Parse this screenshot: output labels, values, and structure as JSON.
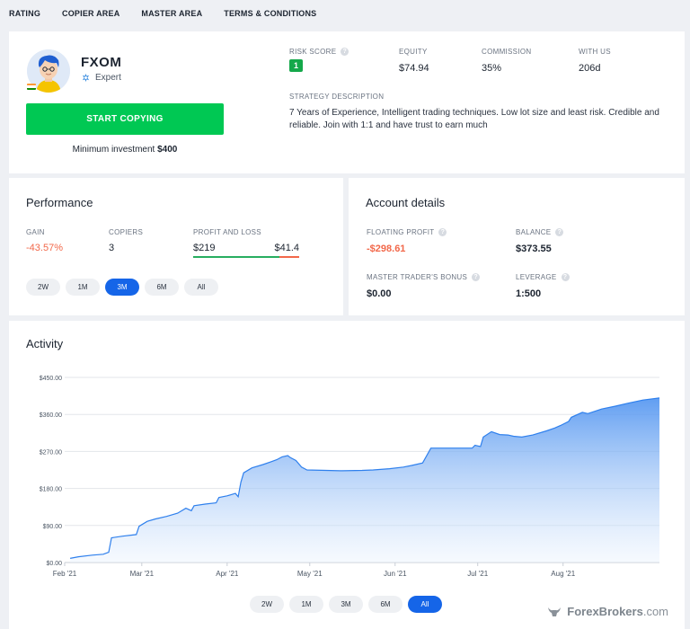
{
  "nav": {
    "items": [
      "RATING",
      "COPIER AREA",
      "MASTER AREA",
      "TERMS & CONDITIONS"
    ]
  },
  "profile": {
    "name": "FXOM",
    "level": "Expert",
    "start_button": "START COPYING",
    "min_investment_label": "Minimum investment",
    "min_investment_value": "$400",
    "risk_score_label": "RISK SCORE",
    "risk_score_value": "1",
    "equity_label": "EQUITY",
    "equity_value": "$74.94",
    "commission_label": "COMMISSION",
    "commission_value": "35%",
    "with_us_label": "WITH US",
    "with_us_value": "206d",
    "strategy_label": "STRATEGY DESCRIPTION",
    "strategy_text": "7 Years of Experience, Intelligent trading techniques. Low lot size and least risk. Credible and reliable. Join with 1:1 and have trust to earn much"
  },
  "performance": {
    "title": "Performance",
    "gain_label": "GAIN",
    "gain_value": "-43.57%",
    "copiers_label": "COPIERS",
    "copiers_value": "3",
    "pl_label": "PROFIT AND LOSS",
    "pl_profit": "$219",
    "pl_loss": "$41.4",
    "periods": [
      "2W",
      "1M",
      "3M",
      "6M",
      "All"
    ],
    "active_period": "3M"
  },
  "account": {
    "title": "Account details",
    "floating_profit_label": "FLOATING PROFIT",
    "floating_profit_value": "-$298.61",
    "balance_label": "BALANCE",
    "balance_value": "$373.55",
    "bonus_label": "MASTER TRADER'S BONUS",
    "bonus_value": "$0.00",
    "leverage_label": "LEVERAGE",
    "leverage_value": "1:500"
  },
  "activity": {
    "title": "Activity",
    "periods": [
      "2W",
      "1M",
      "3M",
      "6M",
      "All"
    ],
    "active_period": "All"
  },
  "watermark": {
    "brand": "ForexBrokers",
    "suffix": ".com"
  },
  "colors": {
    "accent_green": "#00c853",
    "accent_blue": "#1565e8",
    "negative": "#f2684a",
    "line": "#2f80ed"
  },
  "chart_data": {
    "type": "area",
    "title": "Activity",
    "xlabel": "",
    "ylabel": "",
    "ylim": [
      0,
      450
    ],
    "y_ticks": [
      "$0.00",
      "$90.00",
      "$180.00",
      "$270.00",
      "$360.00",
      "$450.00"
    ],
    "y_tick_values": [
      0,
      90,
      180,
      270,
      360,
      450
    ],
    "x_ticks": [
      "Feb '21",
      "Mar '21",
      "Apr '21",
      "May '21",
      "Jun '21",
      "Jul '21",
      "Aug '21"
    ],
    "x_tick_days": [
      0,
      28,
      59,
      89,
      120,
      150,
      181
    ],
    "grid": true,
    "series": [
      {
        "points": [
          [
            2,
            10
          ],
          [
            5,
            14
          ],
          [
            10,
            18
          ],
          [
            14,
            20
          ],
          [
            16,
            25
          ],
          [
            17,
            60
          ],
          [
            21,
            64
          ],
          [
            26,
            68
          ],
          [
            27,
            88
          ],
          [
            30,
            100
          ],
          [
            33,
            106
          ],
          [
            37,
            112
          ],
          [
            41,
            120
          ],
          [
            44,
            132
          ],
          [
            46,
            126
          ],
          [
            47,
            138
          ],
          [
            51,
            142
          ],
          [
            55,
            145
          ],
          [
            56,
            158
          ],
          [
            59,
            162
          ],
          [
            62,
            168
          ],
          [
            63,
            160
          ],
          [
            64,
            195
          ],
          [
            65,
            218
          ],
          [
            68,
            230
          ],
          [
            72,
            238
          ],
          [
            75,
            245
          ],
          [
            77,
            250
          ],
          [
            79,
            257
          ],
          [
            81,
            260
          ],
          [
            82,
            255
          ],
          [
            84,
            248
          ],
          [
            86,
            232
          ],
          [
            88,
            225
          ],
          [
            95,
            224
          ],
          [
            100,
            223
          ],
          [
            108,
            224
          ],
          [
            112,
            225
          ],
          [
            118,
            228
          ],
          [
            123,
            232
          ],
          [
            126,
            236
          ],
          [
            130,
            242
          ],
          [
            133,
            278
          ],
          [
            138,
            278
          ],
          [
            148,
            278
          ],
          [
            149,
            285
          ],
          [
            151,
            282
          ],
          [
            152,
            305
          ],
          [
            155,
            318
          ],
          [
            158,
            311
          ],
          [
            161,
            310
          ],
          [
            163,
            307
          ],
          [
            166,
            305
          ],
          [
            170,
            310
          ],
          [
            175,
            320
          ],
          [
            178,
            327
          ],
          [
            180,
            333
          ],
          [
            183,
            343
          ],
          [
            184,
            353
          ],
          [
            188,
            365
          ],
          [
            190,
            362
          ],
          [
            195,
            373
          ],
          [
            200,
            380
          ],
          [
            205,
            388
          ],
          [
            210,
            395
          ],
          [
            216,
            400
          ]
        ]
      }
    ]
  }
}
